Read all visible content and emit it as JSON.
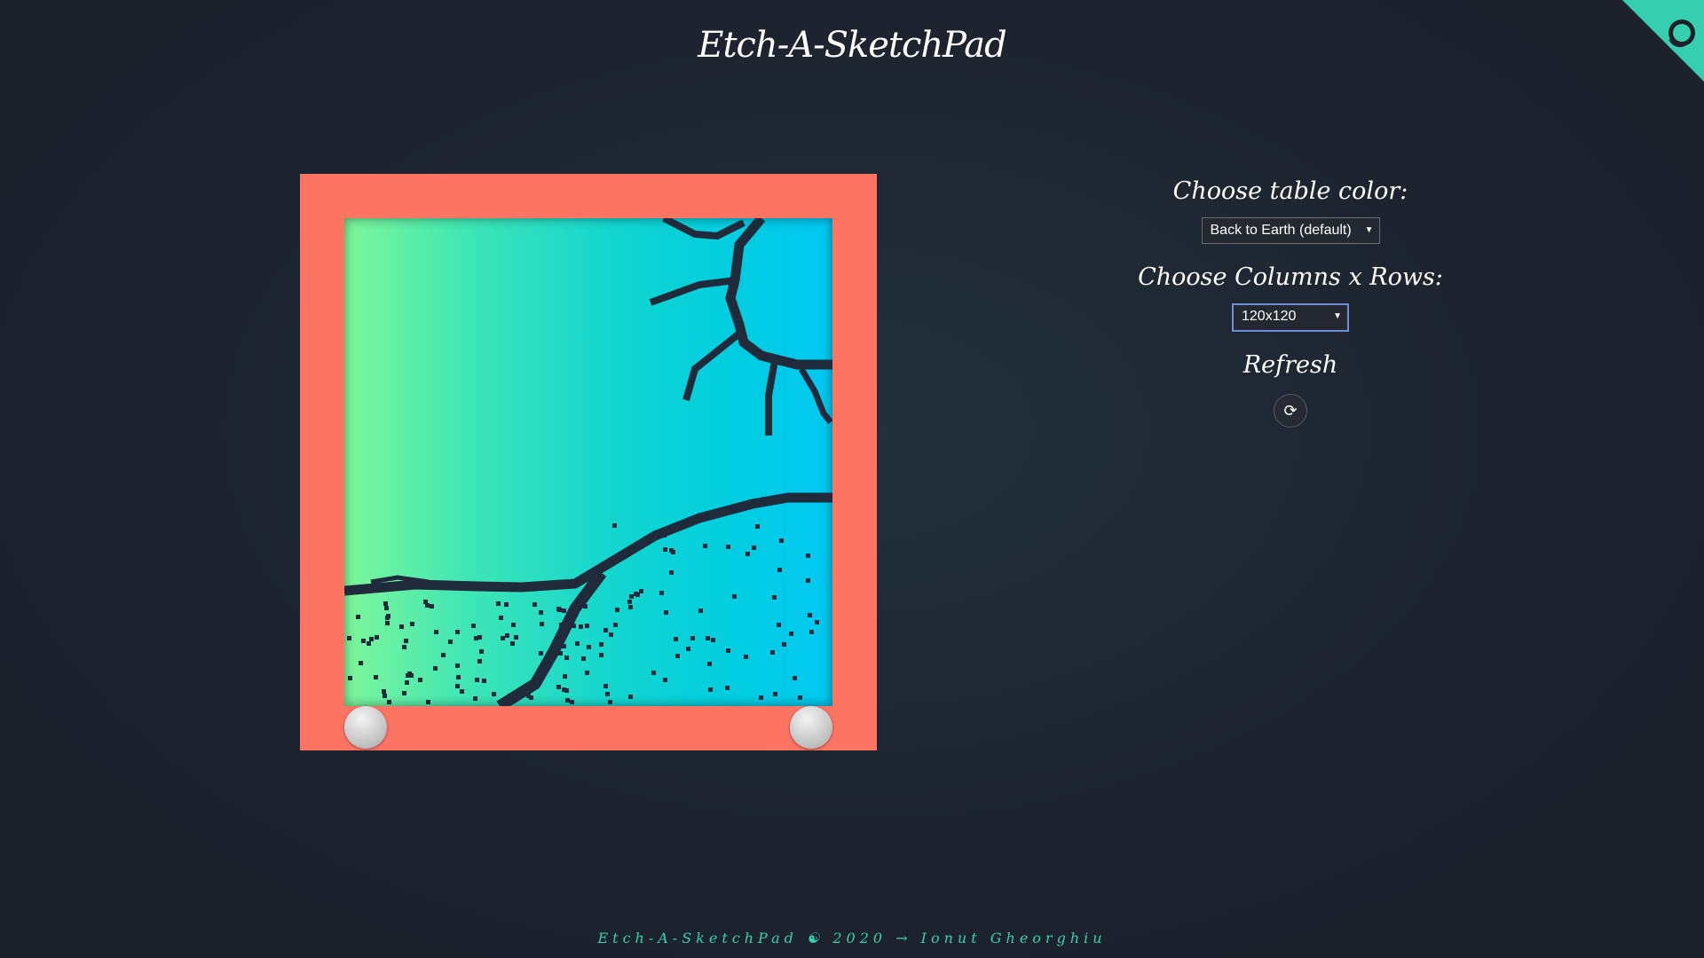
{
  "header": {
    "title": "Etch-A-SketchPad"
  },
  "corner": {
    "icon": "github-icon",
    "color": "#36d0b0"
  },
  "controls": {
    "color_label": "Choose table color:",
    "color_value": "Back to Earth (default)",
    "grid_label": "Choose Columns x Rows:",
    "grid_value": "120x120",
    "refresh_label": "Refresh",
    "refresh_icon": "refresh-icon"
  },
  "board": {
    "frame_color": "#fd7463",
    "ink_color": "#1f2a3a",
    "grid_size": 120
  },
  "footer": {
    "text": "Etch-A-SketchPad ☯ 2020 → Ionut Gheorghiu"
  }
}
